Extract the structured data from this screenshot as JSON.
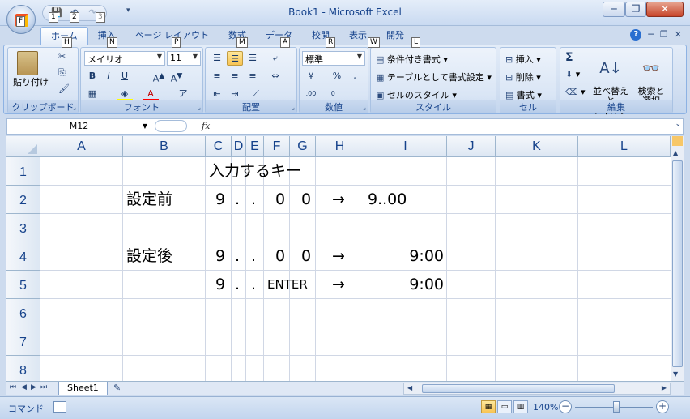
{
  "window": {
    "title": "Book1 - Microsoft Excel",
    "minimize": "─",
    "restore": "❐",
    "close": "✕"
  },
  "qat": {
    "save": "💾",
    "undo": "↶",
    "redo": "↷",
    "dropdown": "▾",
    "keytips": [
      "1",
      "2",
      "3"
    ]
  },
  "tabs": [
    {
      "label": "ホーム",
      "key": "H"
    },
    {
      "label": "挿入",
      "key": "N"
    },
    {
      "label": "ページ レイアウト",
      "key": "P"
    },
    {
      "label": "数式",
      "key": "M"
    },
    {
      "label": "データ",
      "key": "A"
    },
    {
      "label": "校閲",
      "key": "R"
    },
    {
      "label": "表示",
      "key": "W"
    },
    {
      "label": "開発",
      "key": "L"
    }
  ],
  "ribbon_right": {
    "help": "?",
    "minimize": "─",
    "restore": "❐",
    "close": "✕"
  },
  "ribbon": {
    "clipboard": {
      "label": "クリップボード",
      "paste": "貼り付け"
    },
    "font": {
      "label": "フォント",
      "name": "メイリオ",
      "size": "11",
      "bold": "B",
      "italic": "I",
      "underline": "U"
    },
    "alignment": {
      "label": "配置"
    },
    "number": {
      "label": "数値",
      "format": "標準",
      "percent": "%",
      "comma": ","
    },
    "styles": {
      "label": "スタイル",
      "conditional": "条件付き書式",
      "table": "テーブルとして書式設定",
      "cell_styles": "セルのスタイル"
    },
    "cells": {
      "label": "セル",
      "insert": "挿入",
      "delete": "削除",
      "format": "書式"
    },
    "editing": {
      "label": "編集",
      "sum": "Σ",
      "sort_filter": "並べ替えと\nフィルタ",
      "find_select": "検索と\n選択"
    }
  },
  "formula_bar": {
    "name_box": "M12",
    "fx": "fx",
    "value": ""
  },
  "grid": {
    "columns": [
      "A",
      "B",
      "C",
      "D",
      "E",
      "F",
      "G",
      "H",
      "I",
      "J",
      "K",
      "L"
    ],
    "rows": [
      "1",
      "2",
      "3",
      "4",
      "5",
      "6",
      "7",
      "8"
    ],
    "cells": {
      "C1": "入力するキー",
      "B2": "設定前",
      "C2": "9",
      "D2": ".",
      "E2": ".",
      "F2": "0",
      "G2": "0",
      "H2": "→",
      "I2": "9..00",
      "B4": "設定後",
      "C4": "9",
      "D4": ".",
      "E4": ".",
      "F4": "0",
      "G4": "0",
      "H4": "→",
      "I4": "9:00",
      "C5": "9",
      "D5": ".",
      "E5": ".",
      "F5": "ENTER",
      "H5": "→",
      "I5": "9:00"
    }
  },
  "sheet_tabs": {
    "active": "Sheet1"
  },
  "status": {
    "mode": "コマンド",
    "zoom": "140%",
    "minus": "−",
    "plus": "+"
  }
}
